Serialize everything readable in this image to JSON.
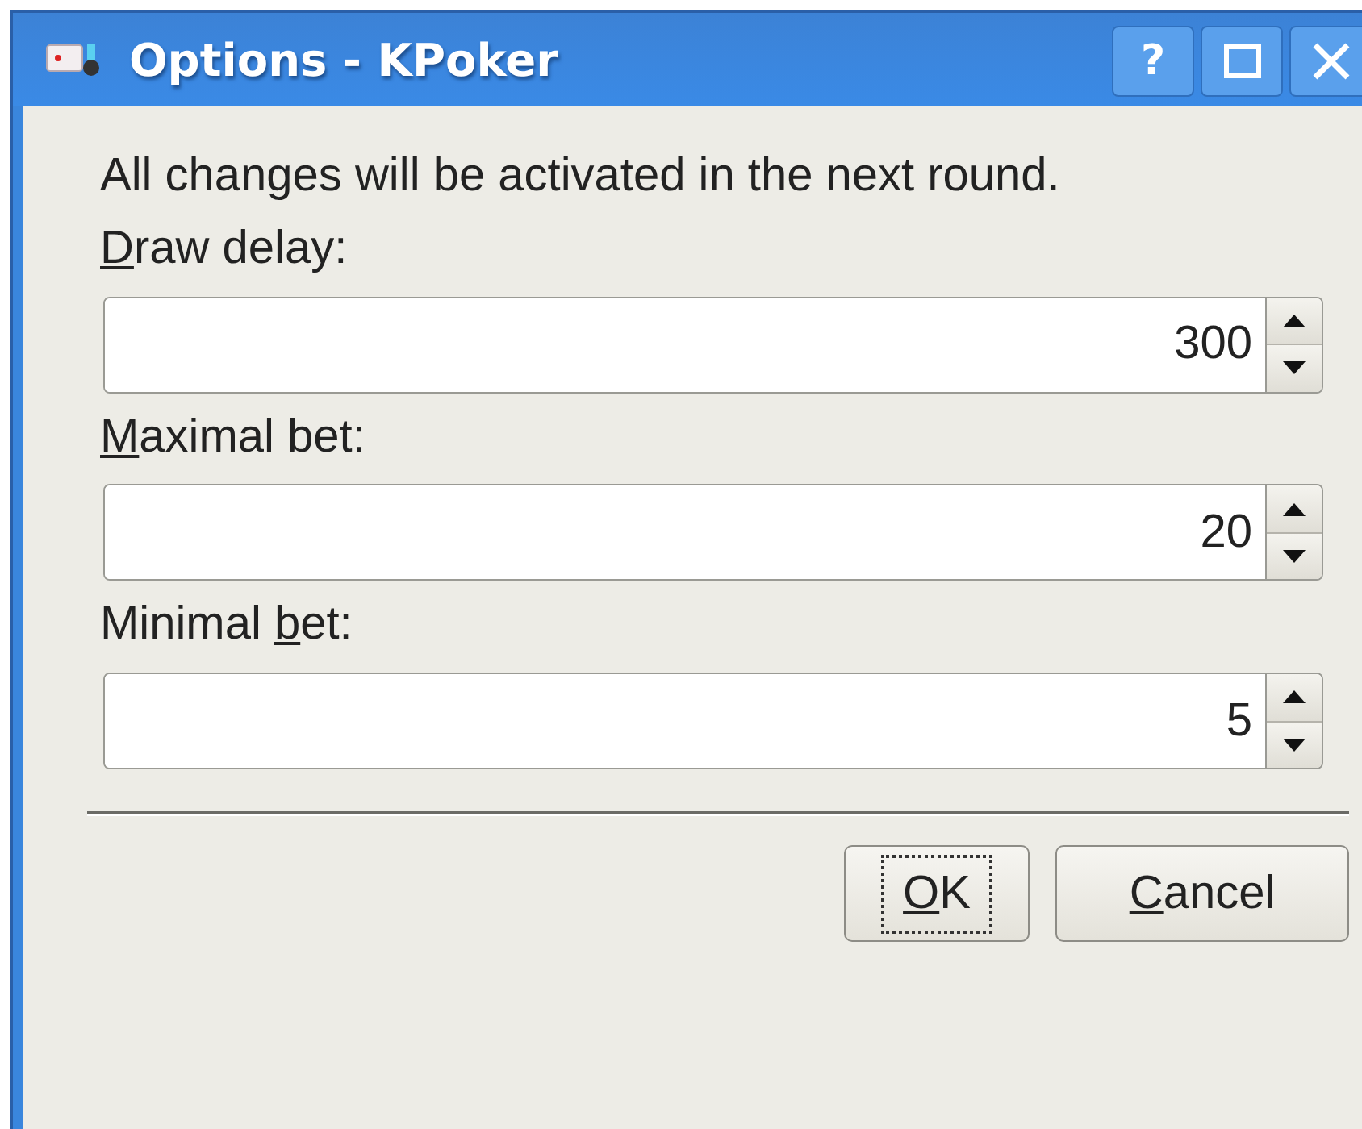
{
  "window": {
    "title": "Options - KPoker",
    "buttons": [
      {
        "kind": "help",
        "label": "?"
      },
      {
        "kind": "maximize"
      },
      {
        "kind": "close"
      }
    ]
  },
  "message": "All changes will be activated in the next round.",
  "fields": [
    {
      "label": {
        "key": "D",
        "after": "raw delay:"
      },
      "value": "300"
    },
    {
      "label": {
        "key": "M",
        "after": "aximal bet:"
      },
      "value": "20"
    },
    {
      "label": {
        "before": "Minimal ",
        "key": "b",
        "after": "et:"
      },
      "value": "5"
    }
  ],
  "buttons": [
    {
      "label": {
        "key": "O",
        "after": "K"
      },
      "focused": true
    },
    {
      "label": {
        "key": "C",
        "after": "ancel"
      },
      "focused": false
    }
  ]
}
